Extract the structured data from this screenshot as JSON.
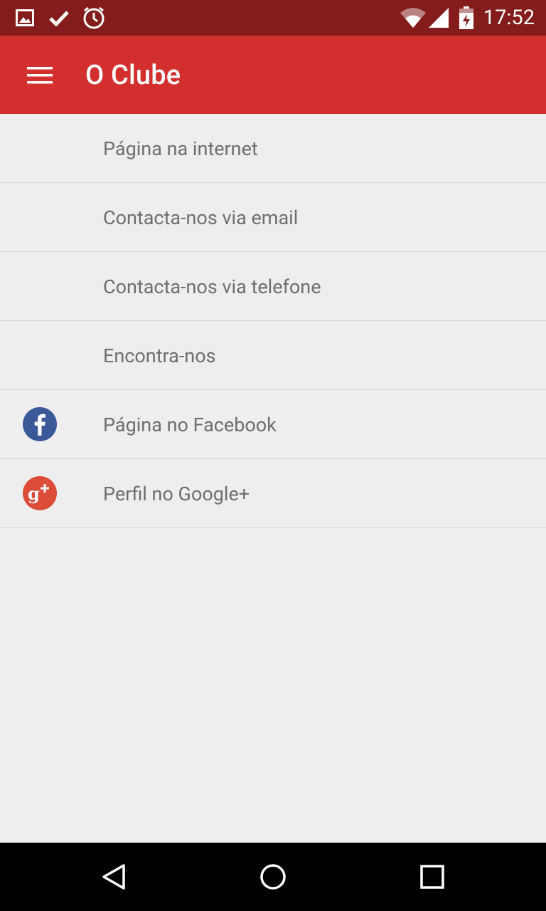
{
  "status_bar": {
    "time": "17:52",
    "icons": [
      "image-icon",
      "check-icon",
      "alarm-icon",
      "wifi-icon",
      "signal-icon",
      "battery-charging-icon"
    ]
  },
  "app_bar": {
    "title": "O Clube",
    "menu_icon": "hamburger-menu-icon"
  },
  "list": {
    "items": [
      {
        "label": "Página na internet",
        "icon": null
      },
      {
        "label": "Contacta-nos via email",
        "icon": null
      },
      {
        "label": "Contacta-nos via telefone",
        "icon": null
      },
      {
        "label": "Encontra-nos",
        "icon": null
      },
      {
        "label": "Página no Facebook",
        "icon": "facebook-icon"
      },
      {
        "label": "Perfil no Google+",
        "icon": "google-plus-icon"
      }
    ]
  },
  "nav_bar": {
    "buttons": [
      "back-icon",
      "home-icon",
      "recents-icon"
    ]
  },
  "colors": {
    "status_bar": "#841c1c",
    "app_bar": "#d42f2f",
    "background": "#eeeeee",
    "facebook": "#3b5998",
    "google_plus": "#dd4b39",
    "text": "#6e6e6e",
    "divider": "#d6d6d6"
  }
}
